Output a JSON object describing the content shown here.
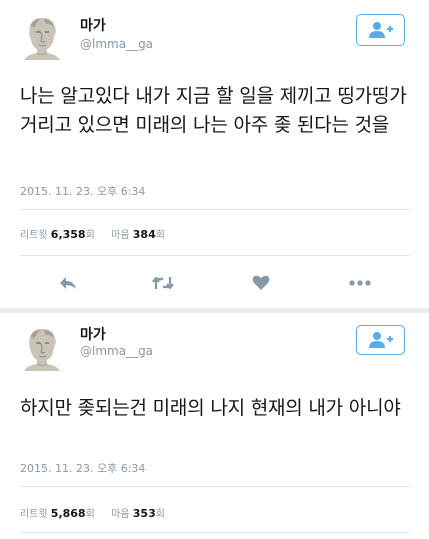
{
  "colors": {
    "accent": "#55acee",
    "text": "#14171a",
    "muted": "#8899a6",
    "icon": "#8899a6",
    "divider": "#e1e8ed",
    "separator": "#e6ecf0"
  },
  "tweets": [
    {
      "display_name": "마가",
      "handle": "@lmma__ga",
      "avatar_icon": "statue-bust-avatar-icon",
      "follow_icon": "add-user-icon",
      "text": "나는 알고있다 내가 지금 할 일을 제끼고 띵가띵가 거리고 있으면 미래의 나는 아주 좆 된다는 것을",
      "timestamp": "2015. 11. 23. 오후 6:34",
      "retweets_label": "리트윗",
      "retweets_count": "6,358",
      "retweets_unit": "회",
      "likes_label": "마음",
      "likes_count": "384",
      "likes_unit": "회",
      "action_icons": [
        "reply-icon",
        "retweet-icon",
        "heart-icon",
        "more-icon"
      ]
    },
    {
      "display_name": "마가",
      "handle": "@lmma__ga",
      "avatar_icon": "statue-bust-avatar-icon",
      "follow_icon": "add-user-icon",
      "text": "하지만 좆되는건 미래의 나지 현재의 내가 아니야",
      "timestamp": "2015. 11. 23. 오후 6:34",
      "retweets_label": "리트윗",
      "retweets_count": "5,868",
      "retweets_unit": "회",
      "likes_label": "마음",
      "likes_count": "353",
      "likes_unit": "회"
    }
  ]
}
